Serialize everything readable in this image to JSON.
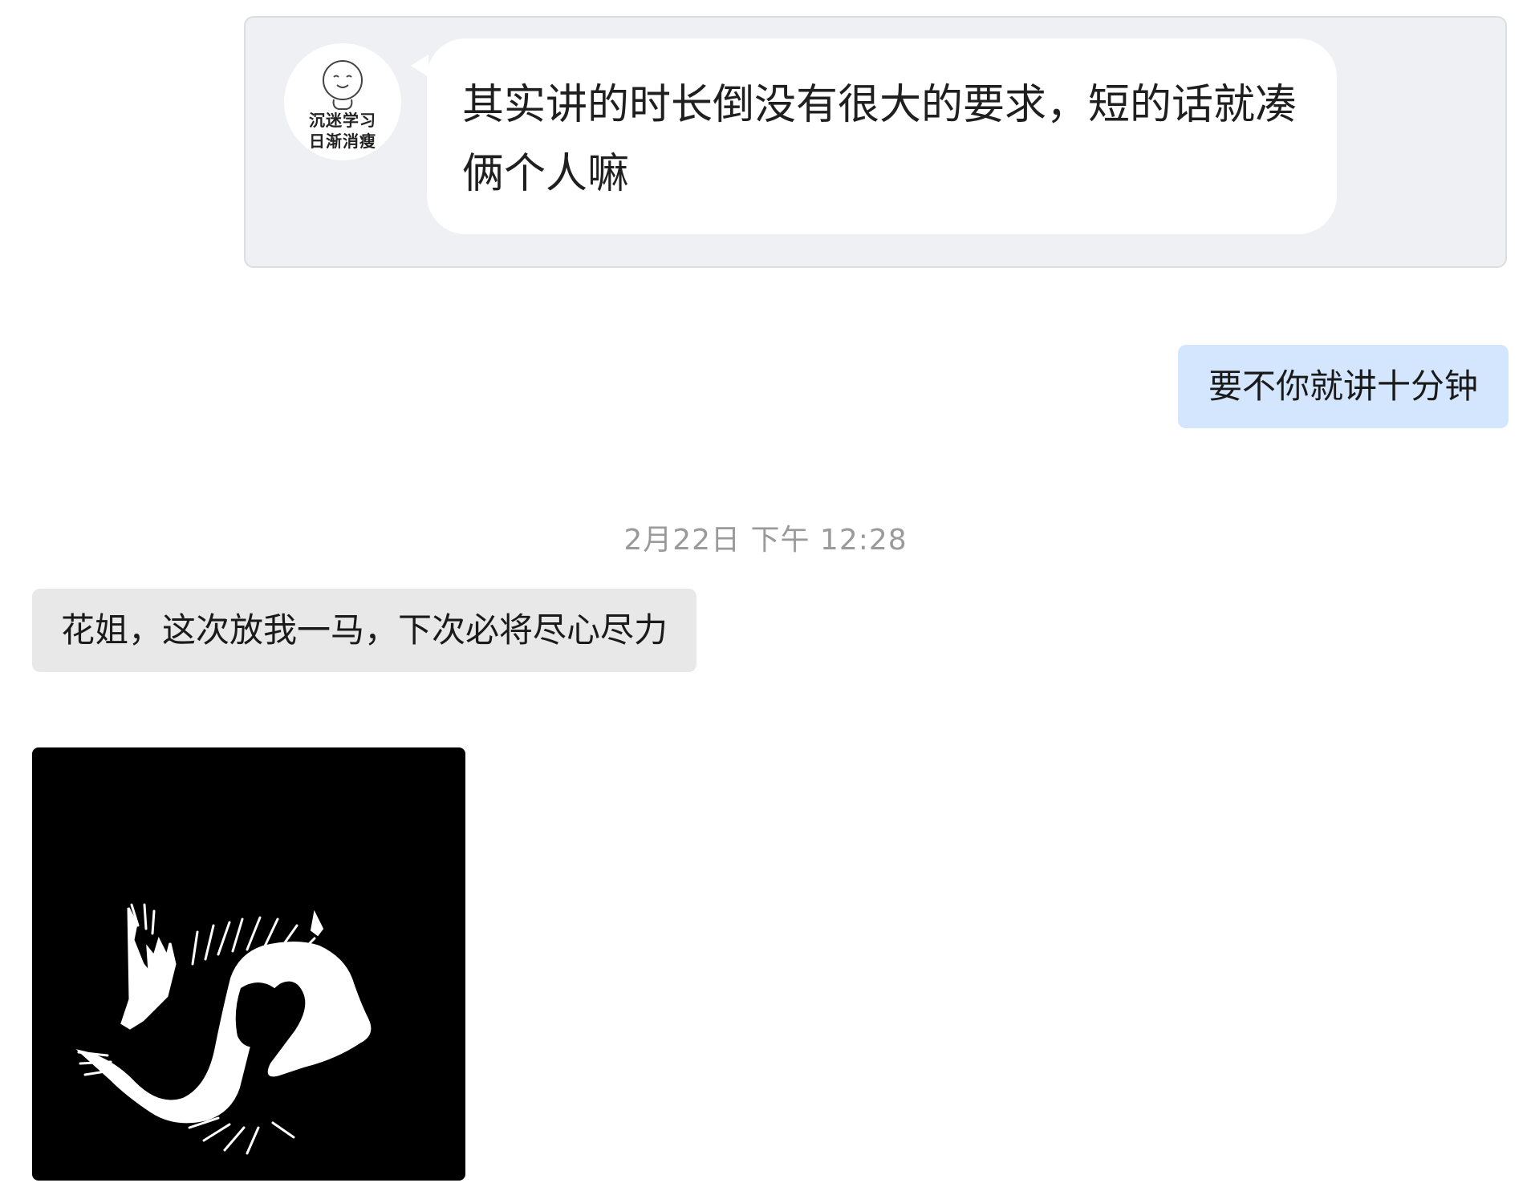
{
  "quoted_message": {
    "avatar_line1": "沉迷学习",
    "avatar_line2": "日渐消瘦",
    "text": "其实讲的时长倒没有很大的要求，短的话就凑俩个人嘛"
  },
  "sent_message": {
    "text": "要不你就讲十分钟"
  },
  "timestamp": "2月22日 下午 12:28",
  "received_message": {
    "text": "花姐，这次放我一马，下次必将尽心尽力"
  },
  "sticker": {
    "icon": "brush-calligraphy-sticker",
    "background_color": "#000000",
    "stroke_color": "#ffffff"
  },
  "colors": {
    "sent_bubble": "#d3e6fd",
    "received_bubble": "#e8e8e8",
    "quote_card": "#eff0f3",
    "timestamp_text": "#9a9a9a"
  }
}
